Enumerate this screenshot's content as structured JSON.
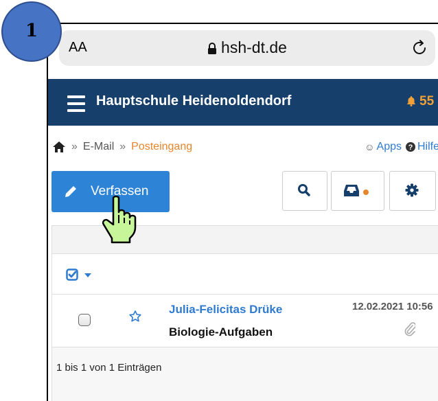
{
  "badge": {
    "number": "1"
  },
  "browser": {
    "aa_label": "AA",
    "domain": "hsh-dt.de"
  },
  "navbar": {
    "title": "Hauptschule Heidenoldendorf",
    "notification_count": "55"
  },
  "breadcrumb": {
    "sep": "»",
    "items": [
      "E-Mail",
      "Posteingang"
    ]
  },
  "links": {
    "apps": "Apps",
    "help": "Hilfe"
  },
  "toolbar": {
    "compose_label": "Verfassen"
  },
  "colors": {
    "navbar": "#163f6b",
    "primary": "#2d83d6",
    "accent": "#e8852b",
    "link": "#2e7bcf"
  },
  "messages": [
    {
      "sender": "Julia-Felicitas Drüke",
      "subject": "Biologie-Aufgaben",
      "date": "12.02.2021 10:56",
      "has_attachment": true
    }
  ],
  "footer": {
    "count_text": "1 bis 1 von 1 Einträgen"
  }
}
